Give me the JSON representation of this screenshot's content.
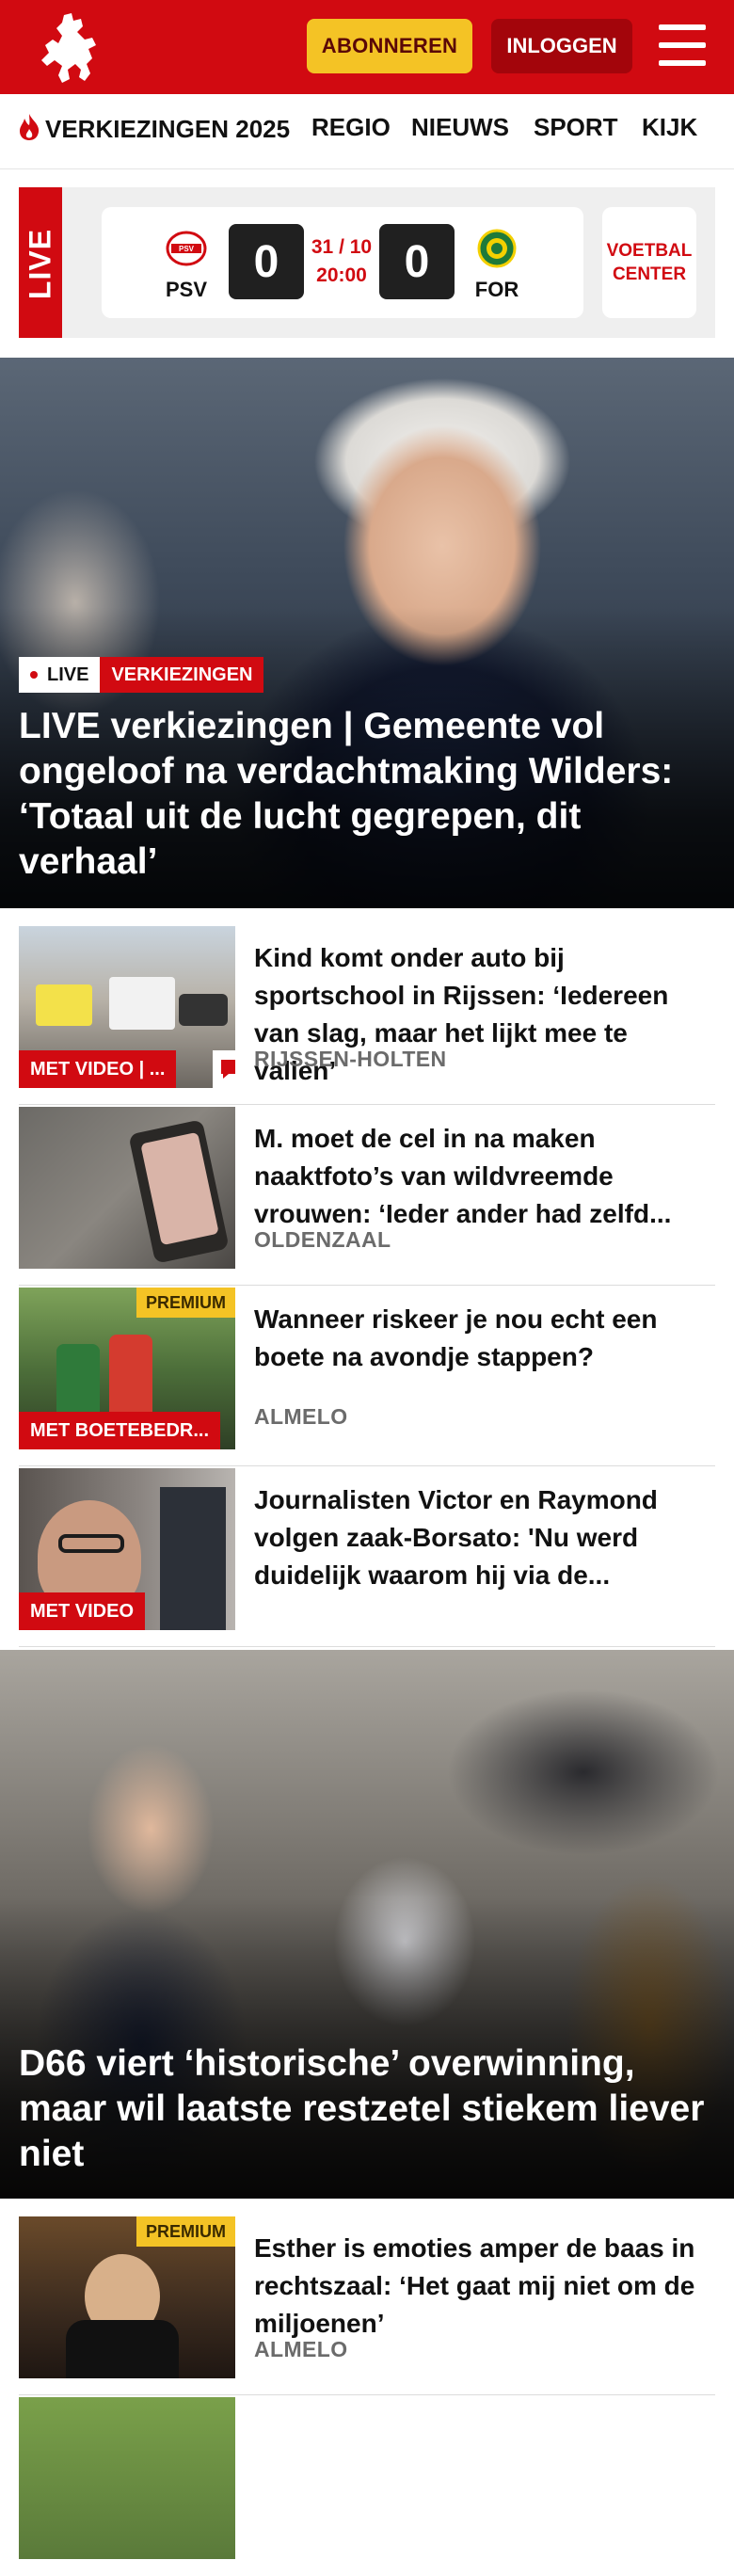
{
  "header": {
    "subscribe_label": "ABONNEREN",
    "login_label": "INLOGGEN",
    "brand_color": "#d10a11"
  },
  "nav": {
    "items": [
      {
        "label": "VERKIEZINGEN 2025",
        "icon": "flame-icon"
      },
      {
        "label": "REGIO"
      },
      {
        "label": "NIEUWS"
      },
      {
        "label": "SPORT"
      },
      {
        "label": "KIJK"
      }
    ]
  },
  "live_match": {
    "live_label": "LIVE",
    "home_team": "PSV",
    "away_team": "FOR",
    "home_score": "0",
    "away_score": "0",
    "date": "31 / 10",
    "time": "20:00",
    "voetbal_center_label": "VOETBAL CENTER"
  },
  "hero_main": {
    "live_label": "LIVE",
    "category_label": "VERKIEZINGEN",
    "title": "LIVE verkiezingen | Gemeente vol ongeloof na verdachtmaking Wilders: ‘Totaal uit de lucht gegrepen, dit verhaal’"
  },
  "articles": [
    {
      "title": "Kind komt onder auto bij sportschool in Rijssen: ‘Iedereen van slag, maar het lijkt mee te vallen’",
      "location": "RIJSSEN-HOLTEN",
      "badge": "MET VIDEO | ...",
      "has_comments": true
    },
    {
      "title": "M. moet de cel in na maken naaktfoto’s van wildvreemde vrouwen: ‘Ieder ander had zelfd...",
      "location": "OLDENZAAL"
    },
    {
      "title": "Wanneer riskeer je nou echt een boete na avondje stappen?",
      "location": "ALMELO",
      "badge": "MET BOETEBEDR...",
      "premium_label": "PREMIUM"
    },
    {
      "title": "Journalisten Victor en Raymond volgen zaak-Borsato: 'Nu werd duidelijk waarom hij via de...",
      "badge": "MET VIDEO"
    }
  ],
  "hero_second": {
    "title": "D66 viert ‘historische’ overwinning, maar wil laatste restzetel stiekem liever niet"
  },
  "articles_2": [
    {
      "title": "Esther is emoties amper de baas in rechtszaal: ‘Het gaat mij niet om de miljoenen’",
      "location": "ALMELO",
      "premium_label": "PREMIUM"
    }
  ]
}
